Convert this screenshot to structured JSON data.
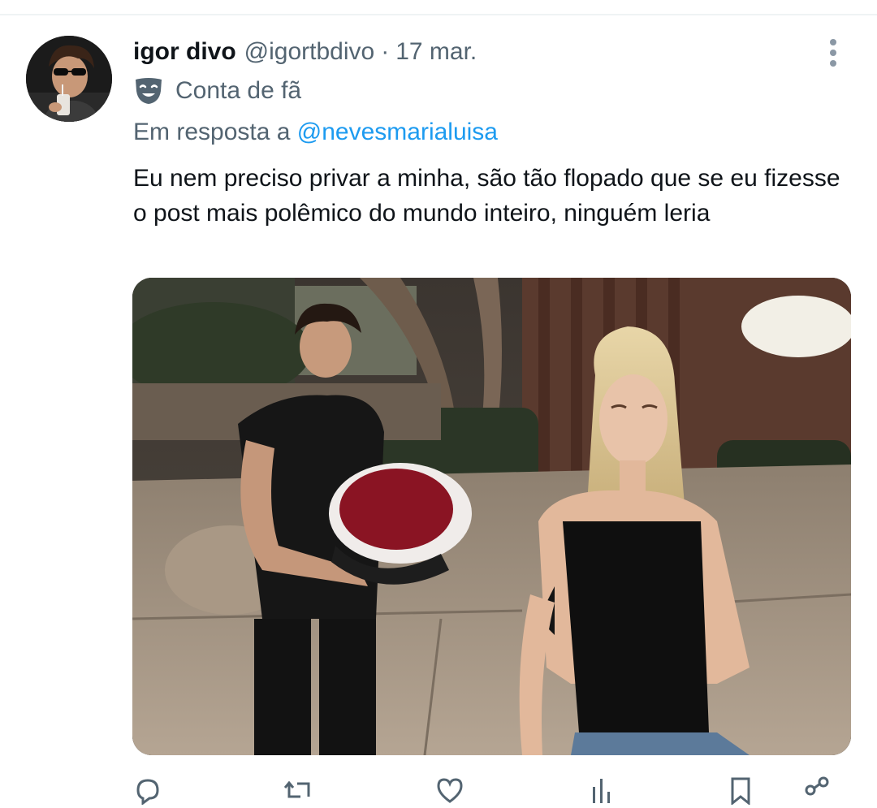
{
  "tweet": {
    "display_name": "igor divo",
    "handle": "@igortbdivo",
    "separator": "·",
    "timestamp": "17 mar.",
    "badge_label": "Conta de fã",
    "reply_prefix": "Em resposta a",
    "reply_to": "@nevesmarialuisa",
    "text": "Eu nem preciso privar a minha, são tão flopado que se eu fizesse o post mais polêmico do mundo inteiro, ninguém leria"
  },
  "icons": {
    "more": "more-vertical-icon",
    "badge": "theater-mask-icon",
    "reply": "reply-icon",
    "retweet": "retweet-icon",
    "like": "heart-icon",
    "views": "views-chart-icon",
    "bookmark": "bookmark-icon",
    "share": "share-icon"
  },
  "colors": {
    "text_primary": "#0f1419",
    "text_secondary": "#536471",
    "link": "#1d9bf0",
    "divider": "#eff3f4"
  }
}
